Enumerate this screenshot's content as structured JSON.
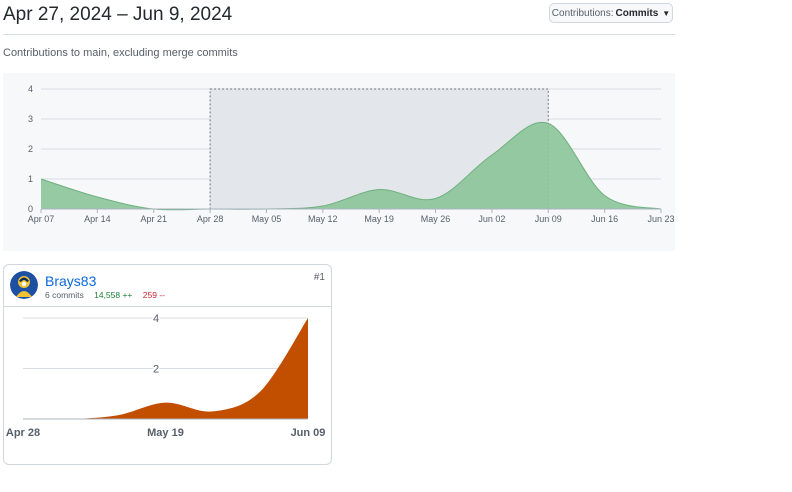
{
  "header": {
    "date_range": "Apr 27, 2024 – Jun 9, 2024",
    "contributions_prefix": "Contributions:",
    "contributions_value": "Commits"
  },
  "subtitle": "Contributions to main, excluding merge commits",
  "colors": {
    "main_area": "#8cc59a",
    "main_area_stroke": "#6fb07f",
    "user_area": "#c24e00",
    "selection_fill": "#e3e6ea",
    "selection_stroke": "#6e7781"
  },
  "chart_data": [
    {
      "type": "area",
      "x_labels": [
        "Apr 07",
        "Apr 14",
        "Apr 21",
        "Apr 28",
        "May 05",
        "May 12",
        "May 19",
        "May 26",
        "Jun 02",
        "Jun 09",
        "Jun 16",
        "Jun 23"
      ],
      "y_ticks": [
        0,
        1,
        2,
        3,
        4
      ],
      "ylim": [
        0,
        4
      ],
      "values": [
        1,
        0.4,
        0,
        0,
        0,
        0.1,
        0.65,
        0.35,
        1.8,
        2.85,
        0.45,
        0
      ],
      "selection": {
        "from": "Apr 28",
        "to": "Jun 09"
      },
      "grid": true
    },
    {
      "type": "area",
      "x_labels": [
        "Apr 28",
        "May 19",
        "Jun 09"
      ],
      "y_ticks": [
        2,
        4
      ],
      "ylim": [
        0,
        4.2
      ],
      "x": [
        0,
        1,
        2,
        3,
        4,
        5,
        6
      ],
      "values": [
        0,
        0,
        0.15,
        0.65,
        0.3,
        1.1,
        4
      ],
      "grid": true
    }
  ],
  "contributor": {
    "username": "Brays83",
    "commits": "6 commits",
    "additions": "14,558 ++",
    "deletions": "259 --",
    "rank": "#1",
    "avatar": "avatar-icon"
  }
}
